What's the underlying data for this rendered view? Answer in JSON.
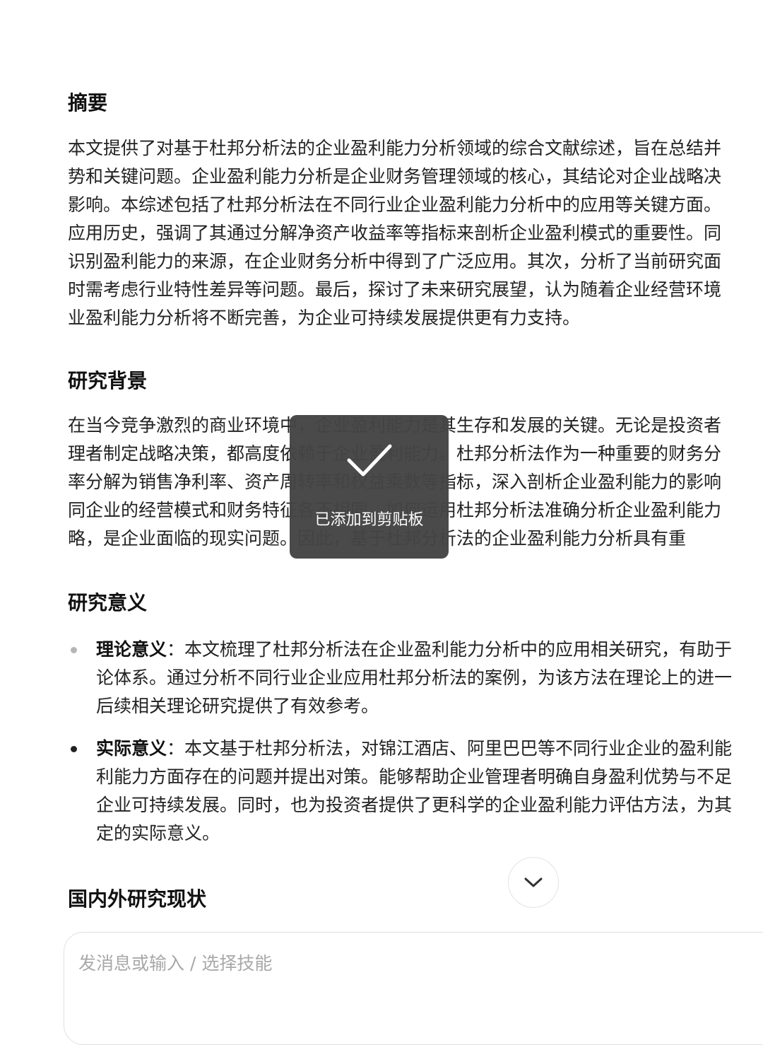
{
  "sections": {
    "abstract": {
      "title": "摘要",
      "lines": [
        "本文提供了对基于杜邦分析法的企业盈利能力分析领域的综合文献综述，旨在总结并",
        "势和关键问题。企业盈利能力分析是企业财务管理领域的核心，其结论对企业战略决",
        "影响。本综述包括了杜邦分析法在不同行业企业盈利能力分析中的应用等关键方面。",
        "应用历史，强调了其通过分解净资产收益率等指标来剖析企业盈利模式的重要性。同",
        "识别盈利能力的来源，在企业财务分析中得到了广泛应用。其次，分析了当前研究面",
        "时需考虑行业特性差异等问题。最后，探讨了未来研究展望，认为随着企业经营环境",
        "业盈利能力分析将不断完善，为企业可持续发展提供更有力支持。"
      ]
    },
    "background": {
      "title": "研究背景",
      "lines": [
        "在当今竞争激烈的商业环境中，企业盈利能力是其生存和发展的关键。无论是投资者",
        "理者制定战略决策，都高度依赖于企业盈利能力。杜邦分析法作为一种重要的财务分",
        "率分解为销售净利率、资产周转率和权益乘数等指标，深入剖析企业盈利能力的影响",
        "同企业的经营模式和财务特征各不相同，如何运用杜邦分析法准确分析企业盈利能力",
        "略，是企业面临的现实问题。因此，基于杜邦分析法的企业盈利能力分析具有重"
      ]
    },
    "significance": {
      "title": "研究意义",
      "items": [
        {
          "label": "理论意义",
          "lines": [
            "：本文梳理了杜邦分析法在企业盈利能力分析中的应用相关研究，有助于",
            "论体系。通过分析不同行业企业应用杜邦分析法的案例，为该方法在理论上的进一",
            "后续相关理论研究提供了有效参考。"
          ]
        },
        {
          "label": "实际意义",
          "lines": [
            "：本文基于杜邦分析法，对锦江酒店、阿里巴巴等不同行业企业的盈利能",
            "利能力方面存在的问题并提出对策。能够帮助企业管理者明确自身盈利优势与不足",
            "企业可持续发展。同时，也为投资者提供了更科学的企业盈利能力评估方法，为其",
            "定的实际意义。"
          ]
        }
      ]
    },
    "status": {
      "title": "国内外研究现状"
    }
  },
  "toast": {
    "icon": "check-icon",
    "message": "已添加到剪贴板"
  },
  "scroll_button": {
    "icon": "chevron-down-icon"
  },
  "composer": {
    "placeholder": "发消息或输入 / 选择技能"
  }
}
